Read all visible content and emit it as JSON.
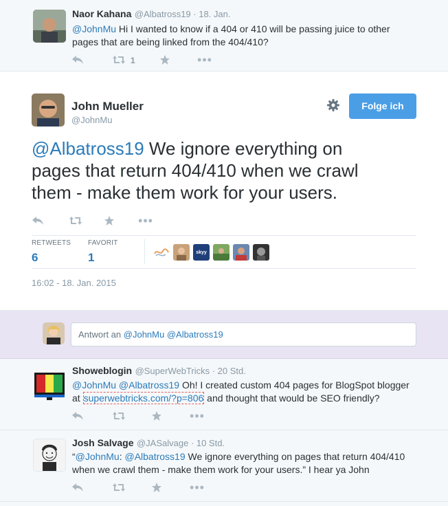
{
  "tweet1": {
    "name": "Naor Kahana",
    "meta": "@Albatross19 · 18. Jan.",
    "mention": "@JohnMu",
    "text_rest": " Hi I wanted to know if a 404 or 410 will be passing juice to other",
    "text_line2": "pages that are being linked from the 404/410?",
    "retweet_count": "1"
  },
  "main": {
    "name": "John Mueller",
    "handle": "@JohnMu",
    "follow_label": "Folge ich",
    "mention": "@Albatross19",
    "line1_rest": " We ignore everything on",
    "line2": "pages that return 404/410 when we crawl",
    "line3": "them - make them work for your users.",
    "retweets_label": "RETWEETS",
    "retweets_value": "6",
    "favorites_label": "FAVORIT",
    "favorites_value": "1",
    "timestamp": "16:02 - 18. Jan. 2015",
    "skyy_label": "skyy"
  },
  "reply_box": {
    "prefix": "Antwort an ",
    "mentions": "@JohnMu @Albatross19"
  },
  "tweet2": {
    "name": "Showeblogin",
    "meta": "@SuperWebTricks · 20 Std.",
    "mentions": "@JohnMu @Albatross19",
    "text_rest": " Oh! I created custom 404 pages for BlogSpot blogger",
    "line2_prefix": "at ",
    "url": "superwebtricks.com/?p=806",
    "line2_rest": " and thought that would be SEO friendly?"
  },
  "tweet3": {
    "name": "Josh Salvage",
    "meta": "@JASalvage · 10 Std.",
    "open_quote": "“",
    "mention1": "@JohnMu",
    "colon": ": ",
    "mention2": "@Albatross19",
    "text_rest": " We ignore everything on pages that return 404/410",
    "line2": "when we crawl them - make them work for your users.” I hear ya John"
  },
  "colors": {
    "link": "#2b7bb9",
    "follow_button": "#4a9ee6",
    "reply_band": "#e8e4f3",
    "page_bg": "#f5f8fa",
    "icon": "#aab8c2"
  }
}
